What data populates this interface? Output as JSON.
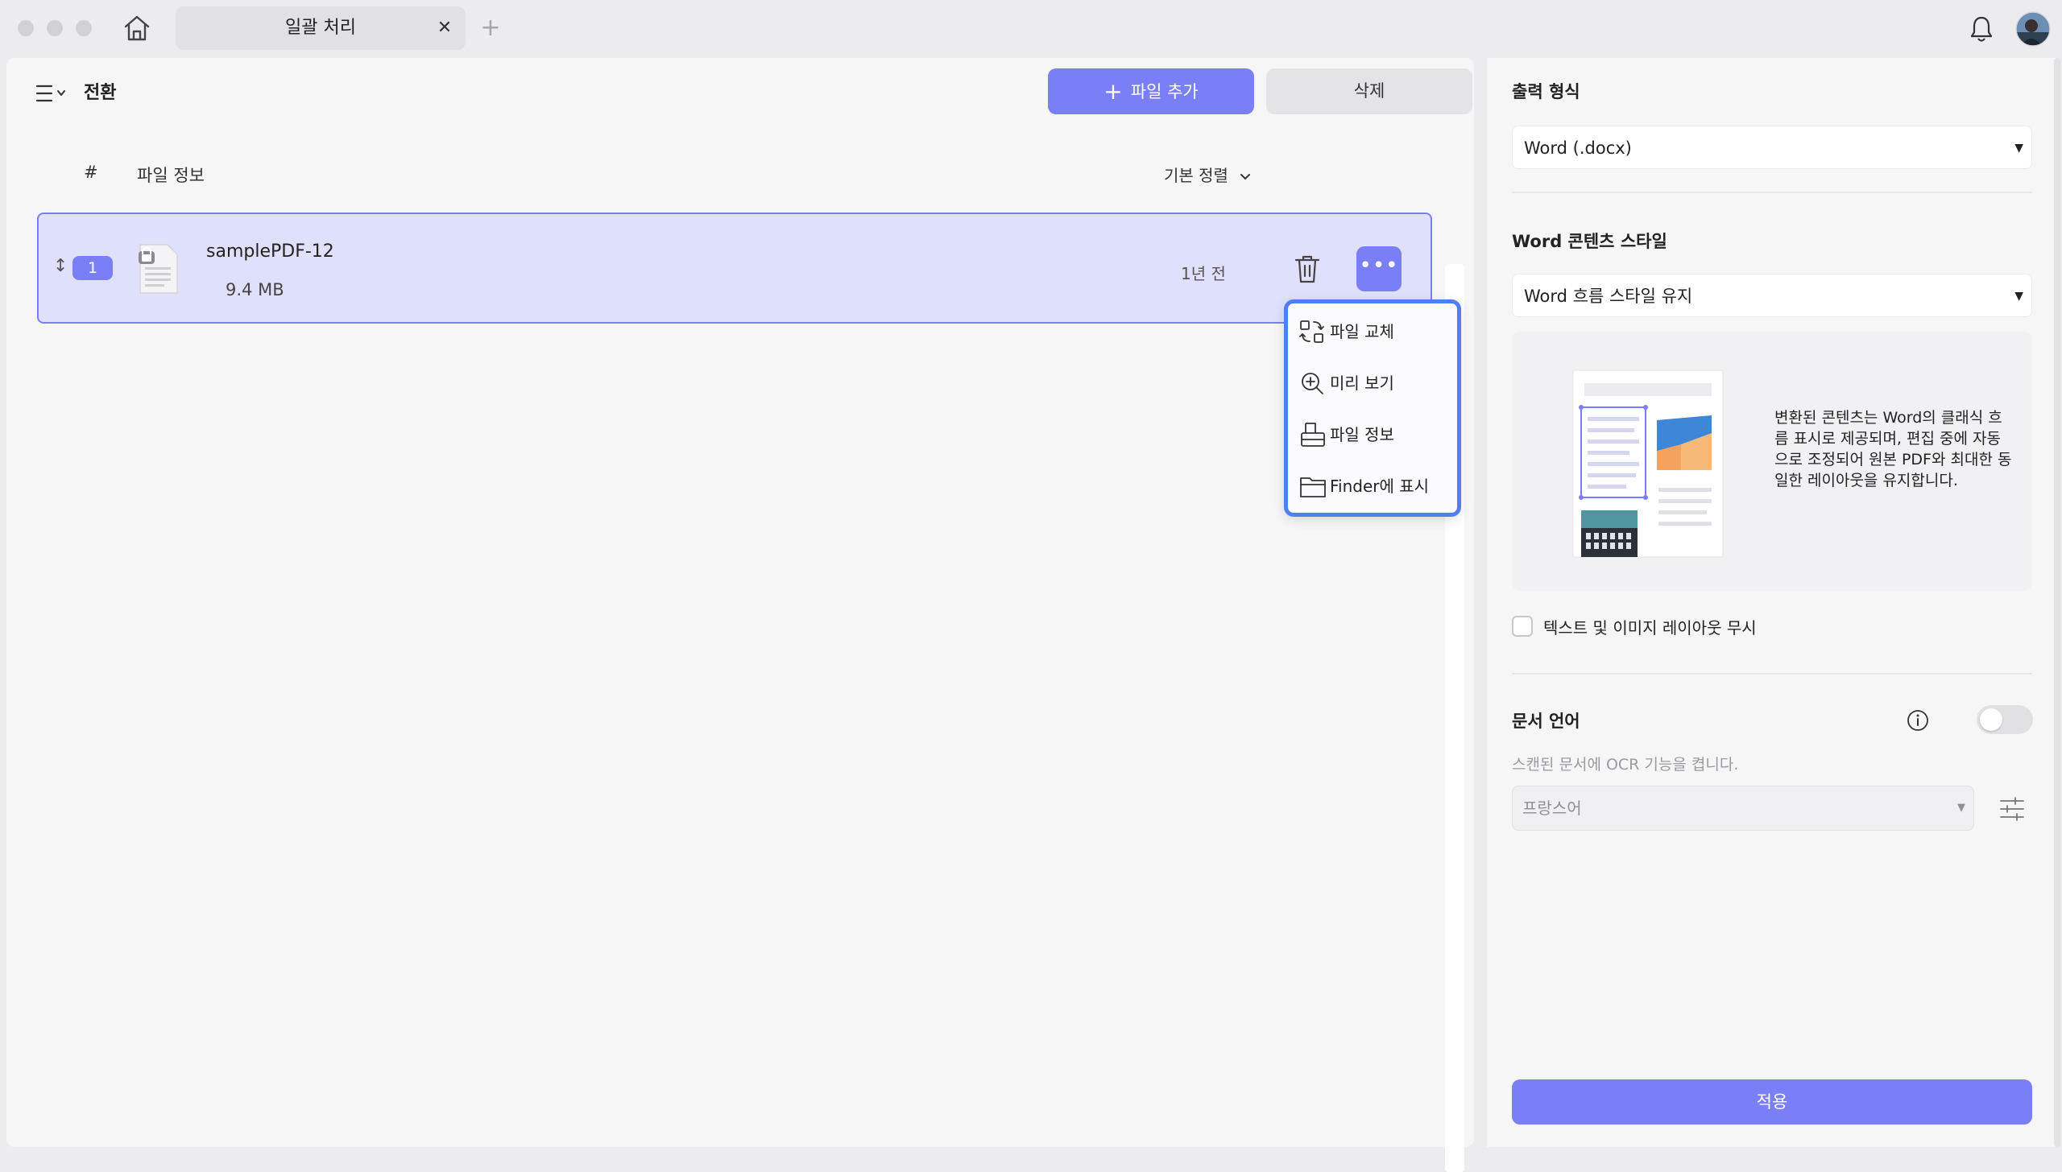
{
  "window": {
    "tab_title": "일괄 처리",
    "tab_close": "✕",
    "tab_add": "+"
  },
  "toolbar": {
    "title": "전환",
    "add_file_label": "파일 추가",
    "delete_label": "삭제"
  },
  "file_list": {
    "col_number": "#",
    "col_info": "파일 정보",
    "sort_label": "기본 정렬",
    "rows": [
      {
        "number": "1",
        "name": "samplePDF-12",
        "size": "9.4 MB",
        "date": "1년 전",
        "locked": true
      }
    ]
  },
  "context_menu": {
    "items": [
      {
        "label": "파일 교체",
        "icon": "replace-file-icon"
      },
      {
        "label": "미리 보기",
        "icon": "zoom-preview-icon"
      },
      {
        "label": "파일 정보",
        "icon": "file-info-icon"
      },
      {
        "label": "Finder에 표시",
        "icon": "folder-icon"
      }
    ]
  },
  "settings": {
    "output_format_label": "출력 형식",
    "output_format_value": "Word (.docx)",
    "content_style_label": "Word 콘텐츠 스타일",
    "content_style_value": "Word 흐름 스타일 유지",
    "style_description": "변환된 콘텐츠는 Word의 클래식 흐름 표시로 제공되며, 편집 중에 자동으로 조정되어 원본 PDF와 최대한 동일한 레이아웃을 유지합니다.",
    "ignore_layout_label": "텍스트 및 이미지 레이아웃 무시",
    "ignore_layout_checked": false,
    "doc_language_label": "문서 언어",
    "ocr_enabled": false,
    "ocr_description": "스캔된 문서에 OCR 기능을 켭니다.",
    "language_value": "프랑스어",
    "apply_label": "적용"
  },
  "colors": {
    "accent": "#7b7ff6",
    "selection_bg": "#dfe0fb",
    "popup_border": "#4f7ff2",
    "background": "#ececee"
  }
}
